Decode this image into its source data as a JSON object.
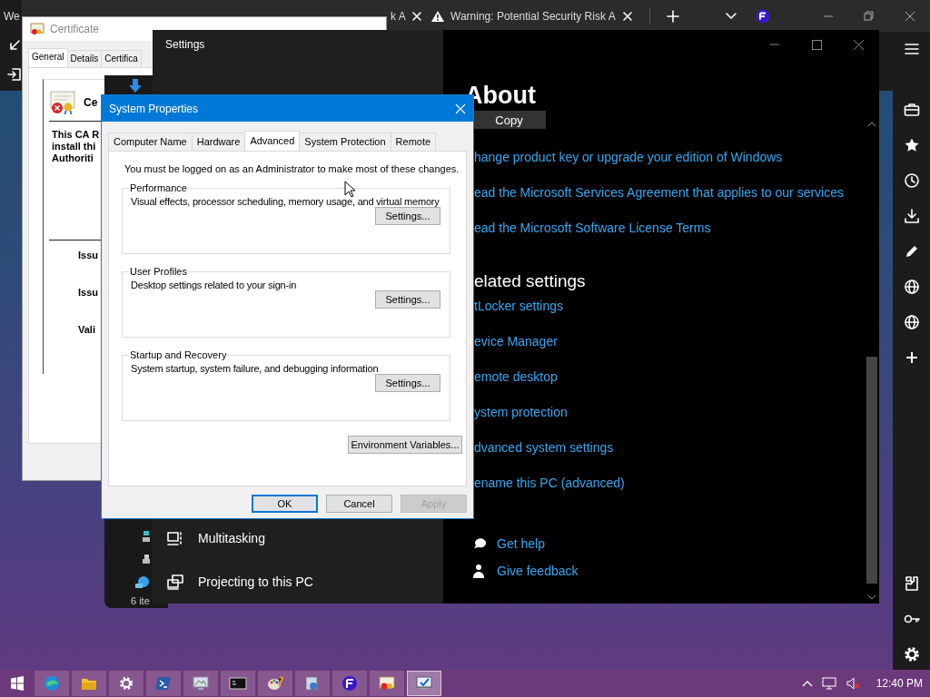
{
  "browser": {
    "tabs": [
      {
        "title": "We",
        "selected": true
      },
      {
        "title": "k A",
        "selected": false
      },
      {
        "title": "Warning: Potential Security Risk A",
        "selected": false
      }
    ]
  },
  "certificate": {
    "title": "Certificate",
    "tabs": [
      {
        "label": "General",
        "selected": true
      },
      {
        "label": "Details",
        "selected": false
      },
      {
        "label": "Certifica",
        "selected": false
      }
    ],
    "heading": "Ce",
    "description": [
      "This CA R",
      "install thi",
      "Authoriti"
    ],
    "fields": [
      "Issu",
      "Issu",
      "Vali"
    ]
  },
  "explorer": {
    "status": "6 ite"
  },
  "settings": {
    "title": "Settings",
    "nav": [
      {
        "label": "Multitasking"
      },
      {
        "label": "Projecting to this PC"
      }
    ],
    "heading": "About",
    "copy_button": "Copy",
    "links": [
      "hange product key or upgrade your edition of Windows",
      "ead the Microsoft Services Agreement that applies to our services",
      "ead the Microsoft Software License Terms"
    ],
    "related_heading": "elated settings",
    "related_links": [
      "tLocker settings",
      "evice Manager",
      "emote desktop",
      "ystem protection",
      "dvanced system settings",
      "ename this PC (advanced)"
    ],
    "help_links": [
      "Get help",
      "Give feedback"
    ]
  },
  "system_properties": {
    "title": "System Properties",
    "tabs": [
      {
        "label": "Computer Name",
        "selected": false
      },
      {
        "label": "Hardware",
        "selected": false
      },
      {
        "label": "Advanced",
        "selected": true
      },
      {
        "label": "System Protection",
        "selected": false
      },
      {
        "label": "Remote",
        "selected": false
      }
    ],
    "notice": "You must be logged on as an Administrator to make most of these changes.",
    "groups": [
      {
        "title": "Performance",
        "description": "Visual effects, processor scheduling, memory usage, and virtual memory",
        "button": "Settings..."
      },
      {
        "title": "User Profiles",
        "description": "Desktop settings related to your sign-in",
        "button": "Settings..."
      },
      {
        "title": "Startup and Recovery",
        "description": "System startup, system failure, and debugging information",
        "button": "Settings..."
      }
    ],
    "environment_button": "Environment Variables...",
    "buttons": [
      {
        "label": "OK",
        "disabled": false
      },
      {
        "label": "Cancel",
        "disabled": false
      },
      {
        "label": "Apply",
        "disabled": true
      }
    ]
  },
  "taskbar": {
    "apps": [
      {
        "selected": false
      },
      {
        "selected": false
      },
      {
        "selected": false
      },
      {
        "selected": false
      },
      {
        "selected": false
      },
      {
        "selected": false
      },
      {
        "selected": false
      },
      {
        "selected": false
      },
      {
        "selected": false
      },
      {
        "selected": false
      },
      {
        "selected": true
      }
    ],
    "clock": "12:40 PM"
  }
}
